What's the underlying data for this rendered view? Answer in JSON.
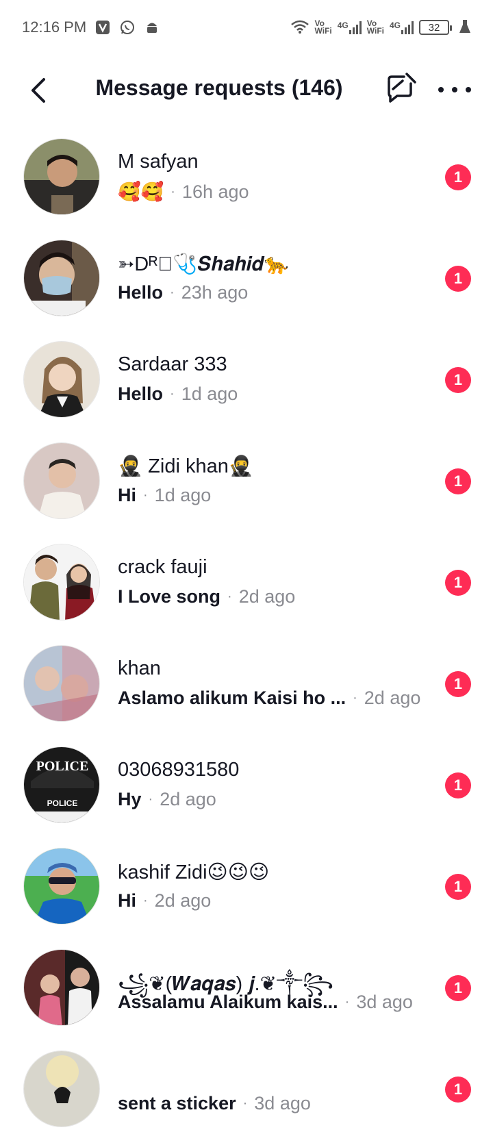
{
  "status_bar": {
    "time": "12:16 PM",
    "icons": [
      "vpn-v-icon",
      "whatsapp-icon",
      "android-icon"
    ],
    "network": [
      "wifi-icon",
      "vowifi-icon",
      "signal-4g-icon",
      "vowifi-icon",
      "signal-4g-icon"
    ],
    "vo_label": "Vo",
    "wifi_label": "WiFi",
    "fourg_label": "4G",
    "battery": "32"
  },
  "header": {
    "title": "Message requests (146)",
    "back_icon": "chevron-left-icon",
    "compose_icon": "compose-off-icon",
    "more_icon": "more-horizontal-icon"
  },
  "requests": [
    {
      "name": "M safyan",
      "message": "🥰🥰",
      "time": "16h ago",
      "badge": "1"
    },
    {
      "name": "➳Dᴿ⃟🩺𝑺𝒉𝒂𝒉𝒊𝒅🐆",
      "message": "Hello",
      "time": "23h ago",
      "badge": "1"
    },
    {
      "name": "Sardaar 333",
      "message": "Hello",
      "time": "1d ago",
      "badge": "1"
    },
    {
      "name": "🥷 Zidi khan🥷",
      "message": "Hi",
      "time": "1d ago",
      "badge": "1"
    },
    {
      "name": "crack fauji",
      "message": "I Love song",
      "time": "2d ago",
      "badge": "1"
    },
    {
      "name": "khan",
      "message": "Aslamo alikum Kaisi ho ...",
      "time": "2d ago",
      "badge": "1"
    },
    {
      "name": "03068931580",
      "message": "Hy",
      "time": "2d ago",
      "badge": "1"
    },
    {
      "name": "kashif Zidi😉😉😉",
      "message": "Hi",
      "time": "2d ago",
      "badge": "1"
    },
    {
      "name": "꧁❦(𝑾𝒂𝒒𝒂𝒔) 𝒋.❦༒꧂",
      "message": "Assalamu Alaikum kais...",
      "time": "3d ago",
      "badge": "1"
    },
    {
      "name": "",
      "message": "sent a sticker",
      "time": "3d ago",
      "badge": "1"
    }
  ],
  "colors": {
    "badge": "#fe2c55",
    "text": "#161823",
    "muted": "#8a8b91"
  }
}
